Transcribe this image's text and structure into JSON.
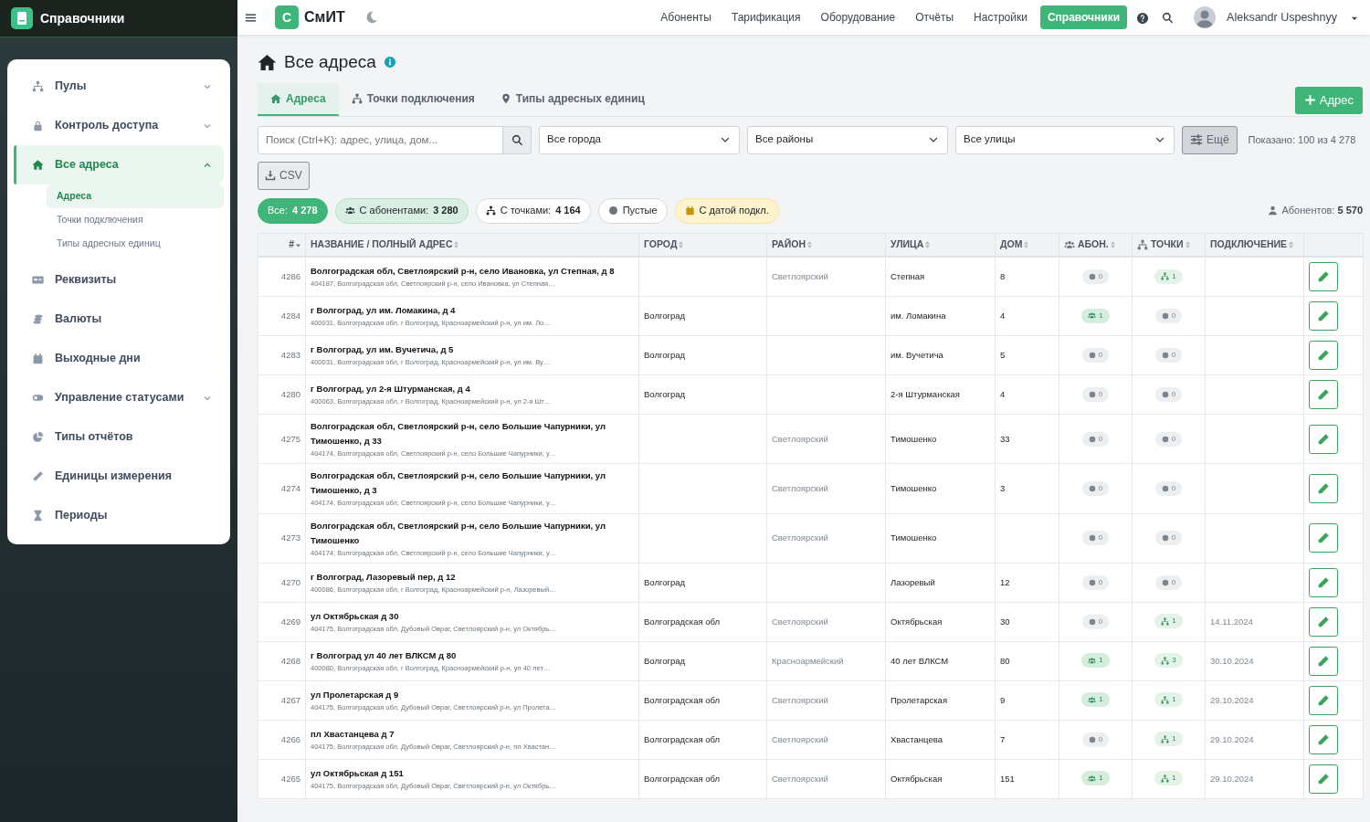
{
  "sidebar": {
    "title": "Справочники",
    "items": [
      {
        "label": "Пулы",
        "kind": "group",
        "expanded": false,
        "selected": false
      },
      {
        "label": "Контроль доступа",
        "kind": "group",
        "expanded": false,
        "selected": false
      },
      {
        "label": "Все адреса",
        "kind": "group",
        "expanded": true,
        "selected": true,
        "children": [
          {
            "label": "Адреса",
            "selected": true
          },
          {
            "label": "Точки подключения",
            "selected": false
          },
          {
            "label": "Типы адресных единиц",
            "selected": false
          }
        ]
      },
      {
        "label": "Реквизиты",
        "kind": "link",
        "selected": false
      },
      {
        "label": "Валюты",
        "kind": "link",
        "selected": false
      },
      {
        "label": "Выходные дни",
        "kind": "link",
        "selected": false
      },
      {
        "label": "Управление статусами",
        "kind": "group",
        "expanded": false,
        "selected": false
      },
      {
        "label": "Типы отчётов",
        "kind": "link",
        "selected": false
      },
      {
        "label": "Единицы измерения",
        "kind": "link",
        "selected": false
      },
      {
        "label": "Периоды",
        "kind": "link",
        "selected": false
      }
    ]
  },
  "topbar": {
    "logo_letter": "С",
    "app_name": "СмИТ",
    "nav": [
      {
        "label": "Абоненты",
        "selected": false
      },
      {
        "label": "Тарификация",
        "selected": false
      },
      {
        "label": "Оборудование",
        "selected": false
      },
      {
        "label": "Отчёты",
        "selected": false
      },
      {
        "label": "Настройки",
        "selected": false
      },
      {
        "label": "Справочники",
        "selected": true
      }
    ],
    "user": "Aleksandr Uspeshnyy"
  },
  "page": {
    "title": "Все адреса",
    "tabs": [
      {
        "label": "Адреса",
        "selected": true
      },
      {
        "label": "Точки подключения",
        "selected": false
      },
      {
        "label": "Типы адресных единиц",
        "selected": false
      }
    ],
    "add_button": "Адрес",
    "search": {
      "placeholder": "Поиск (Ctrl+K): адрес, улица, дом..."
    },
    "filters": [
      "Все города",
      "Все районы",
      "Все улицы"
    ],
    "more_button": "Ещё",
    "shown": "Показано: 100 из 4 278",
    "csv_button": "CSV",
    "chips": [
      {
        "kind": "all",
        "label": "Все:",
        "count": "4 278",
        "selected": true
      },
      {
        "kind": "subs",
        "label": "С абонентами:",
        "count": "3 280",
        "selected": false
      },
      {
        "kind": "points",
        "label": "С точками:",
        "count": "4 164",
        "selected": false
      },
      {
        "kind": "empty",
        "label": "Пустые",
        "selected": false
      },
      {
        "kind": "date",
        "label": "С датой подкл.",
        "selected": false
      }
    ],
    "subscribers_total": {
      "label": "Абонентов:",
      "value": "5 570"
    }
  },
  "table": {
    "columns": [
      {
        "label": "#",
        "sorted": true
      },
      {
        "label": "НАЗВАНИЕ / ПОЛНЫЙ АДРЕС",
        "sorted": false
      },
      {
        "label": "ГОРОД",
        "sorted": false
      },
      {
        "label": "РАЙОН",
        "sorted": false
      },
      {
        "label": "УЛИЦА",
        "sorted": false
      },
      {
        "label": "ДОМ",
        "sorted": false
      },
      {
        "label": "АБОН.",
        "sorted": false
      },
      {
        "label": "ТОЧКИ",
        "sorted": false
      },
      {
        "label": "ПОДКЛЮЧЕНИЕ",
        "sorted": false
      }
    ],
    "rows": [
      {
        "id": "4286",
        "name": "Волгоградская обл, Светлоярский р-н, село Ивановка, ул Степная, д 8",
        "full": "404187, Волгоградская обл, Светлоярский р-н, село Ивановка, ул Степная…",
        "district": "Светлоярский",
        "street": "Степная",
        "house": "8",
        "subs": {
          "count": "0",
          "active": false
        },
        "points": {
          "count": "1",
          "active": true
        }
      },
      {
        "id": "4284",
        "name": "г Волгоград, ул им. Ломакина, д 4",
        "full": "400031, Волгоградская обл, г Волгоград, Красноармейский р-н, ул им. Ло…",
        "city": "Волгоград",
        "street": "им. Ломакина",
        "house": "4",
        "subs": {
          "count": "1",
          "active": true
        },
        "points": {
          "count": "0",
          "active": false
        }
      },
      {
        "id": "4283",
        "name": "г Волгоград, ул им. Вучетича, д 5",
        "full": "400031, Волгоградская обл, г Волгоград, Красноармейский р-н, ул им. Ву…",
        "city": "Волгоград",
        "street": "им. Вучетича",
        "house": "5",
        "subs": {
          "count": "0",
          "active": false
        },
        "points": {
          "count": "0",
          "active": false
        }
      },
      {
        "id": "4280",
        "name": "г Волгоград, ул 2-я Штурманская, д 4",
        "full": "400063, Волгоградская обл, г Волгоград, Красноармейский р-н, ул 2-я Шт…",
        "city": "Волгоград",
        "street": "2-я Штурманская",
        "house": "4",
        "subs": {
          "count": "0",
          "active": false
        },
        "points": {
          "count": "0",
          "active": false
        }
      },
      {
        "id": "4275",
        "name": "Волгоградская обл, Светлоярский р-н, село Большие Чапурники, ул Тимошенко, д 33",
        "full": "404174, Волгоградская обл, Светлоярский р-н, село Большие Чапурники, у…",
        "district": "Светлоярский",
        "street": "Тимошенко",
        "house": "33",
        "subs": {
          "count": "0",
          "active": false
        },
        "points": {
          "count": "0",
          "active": false
        }
      },
      {
        "id": "4274",
        "name": "Волгоградская обл, Светлоярский р-н, село Большие Чапурники, ул Тимошенко, д 3",
        "full": "404174, Волгоградская обл, Светлоярский р-н, село Большие Чапурники, у…",
        "district": "Светлоярский",
        "street": "Тимошенко",
        "house": "3",
        "subs": {
          "count": "0",
          "active": false
        },
        "points": {
          "count": "0",
          "active": false
        }
      },
      {
        "id": "4273",
        "name": "Волгоградская обл, Светлоярский р-н, село Большие Чапурники, ул Тимошенко",
        "full": "404174, Волгоградская обл, Светлоярский р-н, село Большие Чапурники, у…",
        "district": "Светлоярский",
        "street": "Тимошенко",
        "subs": {
          "count": "0",
          "active": false
        },
        "points": {
          "count": "0",
          "active": false
        }
      },
      {
        "id": "4270",
        "name": "г Волгоград, Лазоревый пер, д 12",
        "full": "400086, Волгоградская обл, г Волгоград, Красноармейский р-н, Лазоревый…",
        "city": "Волгоград",
        "street": "Лазоревый",
        "house": "12",
        "subs": {
          "count": "0",
          "active": false
        },
        "points": {
          "count": "0",
          "active": false
        }
      },
      {
        "id": "4269",
        "name": "ул Октябрьская д 30",
        "full": "404175, Волгоградская обл, Дубовый Овраг, Светлоярский р-н, ул Октябрь…",
        "city": "Волгоградская обл",
        "district": "Светлоярский",
        "street": "Октябрьская",
        "house": "30",
        "subs": {
          "count": "0",
          "active": false
        },
        "points": {
          "count": "1",
          "active": true
        },
        "date": "14.11.2024"
      },
      {
        "id": "4268",
        "name": "г Волгоград ул 40 лет ВЛКСМ д 80",
        "full": "400080, Волгоградская обл, г Волгоград, Красноармейский р-н, ул 40 лет…",
        "city": "Волгоград",
        "district": "Красноармейский",
        "street": "40 лет ВЛКСМ",
        "house": "80",
        "subs": {
          "count": "1",
          "active": true
        },
        "points": {
          "count": "3",
          "active": true
        },
        "date": "30.10.2024"
      },
      {
        "id": "4267",
        "name": "ул Пролетарская д 9",
        "full": "404175, Волгоградская обл, Дубовый Овраг, Светлоярский р-н, ул Пролета…",
        "city": "Волгоградская обл",
        "district": "Светлоярский",
        "street": "Пролетарская",
        "house": "9",
        "subs": {
          "count": "1",
          "active": true
        },
        "points": {
          "count": "1",
          "active": true
        },
        "date": "29.10.2024"
      },
      {
        "id": "4266",
        "name": "пл Хвастанцева д 7",
        "full": "404175, Волгоградская обл, Дубовый Овраг, Светлоярский р-н, пл Хвастан…",
        "city": "Волгоградская обл",
        "district": "Светлоярский",
        "street": "Хвастанцева",
        "house": "7",
        "subs": {
          "count": "0",
          "active": false
        },
        "points": {
          "count": "1",
          "active": true
        },
        "date": "29.10.2024"
      },
      {
        "id": "4265",
        "name": "ул Октябрьская д 151",
        "full": "404175, Волгоградская обл, Дубовый Овраг, Светлоярский р-н, ул Октябрь…",
        "city": "Волгоградская обл",
        "district": "Светлоярский",
        "street": "Октябрьская",
        "house": "151",
        "subs": {
          "count": "1",
          "active": true
        },
        "points": {
          "count": "1",
          "active": true
        },
        "date": "29.10.2024"
      }
    ]
  }
}
